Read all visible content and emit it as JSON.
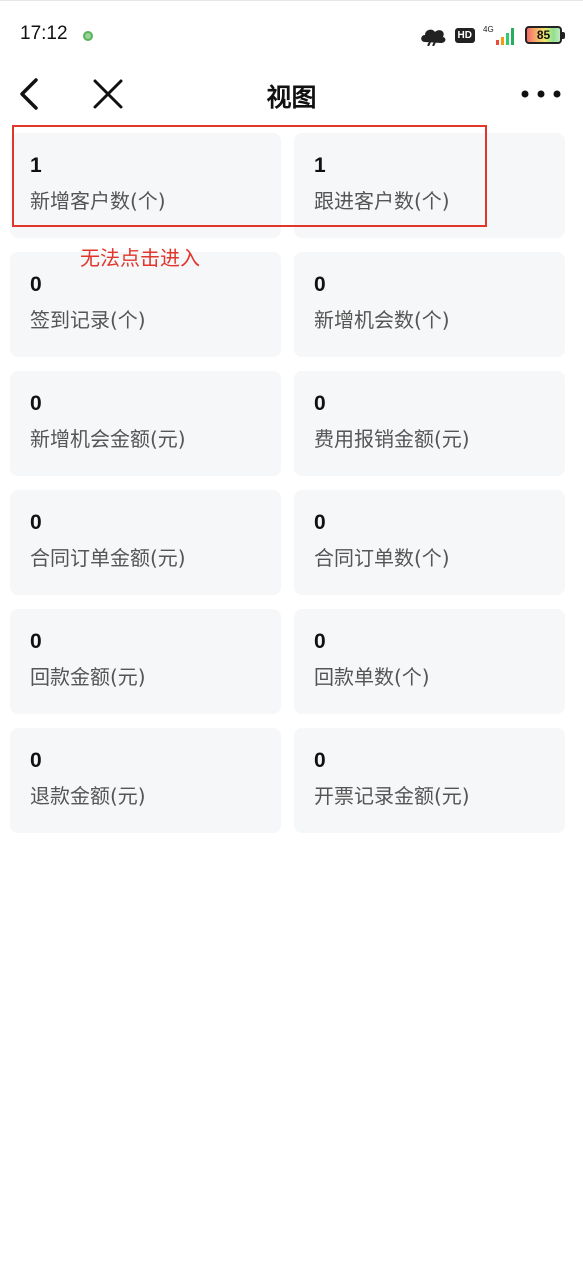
{
  "status_bar": {
    "time": "17:12",
    "network": "4G",
    "hd": "HD",
    "battery": "85"
  },
  "nav": {
    "title": "视图"
  },
  "cards": [
    {
      "value": "1",
      "label": "新增客户数(个)"
    },
    {
      "value": "1",
      "label": "跟进客户数(个)"
    },
    {
      "value": "0",
      "label": "签到记录(个)"
    },
    {
      "value": "0",
      "label": "新增机会数(个)"
    },
    {
      "value": "0",
      "label": "新增机会金额(元)"
    },
    {
      "value": "0",
      "label": "费用报销金额(元)"
    },
    {
      "value": "0",
      "label": "合同订单金额(元)"
    },
    {
      "value": "0",
      "label": "合同订单数(个)"
    },
    {
      "value": "0",
      "label": "回款金额(元)"
    },
    {
      "value": "0",
      "label": "回款单数(个)"
    },
    {
      "value": "0",
      "label": "退款金额(元)"
    },
    {
      "value": "0",
      "label": "开票记录金额(元)"
    }
  ],
  "annotation": {
    "text": "无法点击进入",
    "color": "#e0362c"
  }
}
